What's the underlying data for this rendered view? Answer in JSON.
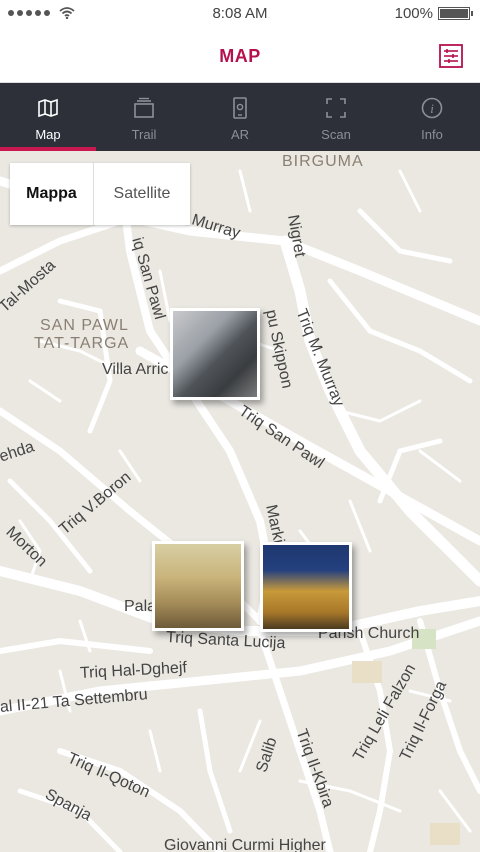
{
  "status_bar": {
    "time": "8:08 AM",
    "battery": "100%",
    "signal_icon": "signal-dots-icon",
    "wifi_icon": "wifi-icon",
    "battery_icon": "battery-icon"
  },
  "header": {
    "title": "MAP",
    "menu_icon": "menu-list-icon",
    "accent": "#b5114f"
  },
  "tabs": [
    {
      "label": "Map",
      "icon": "map-icon",
      "active": true
    },
    {
      "label": "Trail",
      "icon": "trail-stack-icon",
      "active": false
    },
    {
      "label": "AR",
      "icon": "ar-phone-icon",
      "active": false
    },
    {
      "label": "Scan",
      "icon": "scan-frame-icon",
      "active": false
    },
    {
      "label": "Info",
      "icon": "info-icon",
      "active": false
    }
  ],
  "map_type": {
    "active": "Mappa",
    "inactive": "Satellite"
  },
  "map": {
    "area_labels": {
      "birguma": "BIRGUMA",
      "san_pawl_line1": "SAN PAWL",
      "san_pawl_line2": "TAT-TARGA"
    },
    "street_labels": {
      "murray": "Murray",
      "nigret": "Nigret",
      "tal_mosta": "Tal-Mosta",
      "iq_san_pawl": "iq San Pawl",
      "pu_skippon": "pu Skippon",
      "triq_m_murray": "Triq M. Murray",
      "villa_arric": "Villa Arric",
      "triq_san_pawl": "Triq San Pawl",
      "ehda": "ehda",
      "triq_v_boron": "Triq V.Boron",
      "morton": "Morton",
      "marki": "Marki",
      "pala": "Pala",
      "parish_church": "Parish Church",
      "triq_santa_lucija": "Triq Santa Lucija",
      "triq_hal_dghejf": "Triq Hal-Dghejf",
      "triq_settembru": "al II-21 Ta Settembru",
      "triq_leli_falzon": "Triq Leli Falzon",
      "triq_il_forga": "Triq Il-Forga",
      "salib": "Salib",
      "triq_il_kbira": "Triq Il-Kbira",
      "triq_il_qoton": "Triq Il-Qoton",
      "spanja": "Spanja",
      "giovanni_curmi": "Giovanni Curmi Higher"
    }
  }
}
